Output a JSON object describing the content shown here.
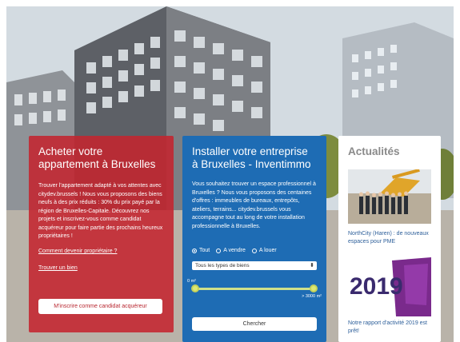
{
  "cards": {
    "buy": {
      "title": "Acheter votre appartement à Bruxelles",
      "text": "Trouver l'appartement adapté à vos attentes avec citydev.brussels ! Nous vous proposons des biens neufs à des prix réduits : 30% du prix payé par la région de Bruxelles-Capitale. Découvrez nos projets et inscrivez-vous comme candidat acquéreur pour faire partie des prochains heureux propriétaires !",
      "link_how": "Comment devenir propriétaire ?",
      "link_find": "Trouver un bien",
      "button": "M'inscrire comme candidat acquéreur",
      "color": "#c4242f"
    },
    "business": {
      "title": "Installer votre entreprise à Bruxelles - Inventimmo",
      "text": "Vous souhaitez trouver un espace professionnel à Bruxelles ? Nous vous proposons des centaines d'offres : immeubles de bureaux, entrepôts, ateliers, terrains... citydev.brussels vous accompagne tout au long de votre installation professionnelle à Bruxelles.",
      "radios": [
        {
          "label": "Tout",
          "checked": true
        },
        {
          "label": "A vendre",
          "checked": false
        },
        {
          "label": "A louer",
          "checked": false
        }
      ],
      "select_value": "Tous les types de biens",
      "range_min": "0 m²",
      "range_max": "> 3000 m²",
      "range_low_fraction": 0.0,
      "range_high_fraction": 1.0,
      "button": "Chercher",
      "color": "#1e6cb4"
    },
    "news": {
      "title": "Actualités",
      "item1_caption": "NorthCity (Haren) : de nouveaux espaces pour PME",
      "item2_caption": "Notre rapport d'activité 2019 est prêt!",
      "item2_image_text": "2019"
    }
  }
}
